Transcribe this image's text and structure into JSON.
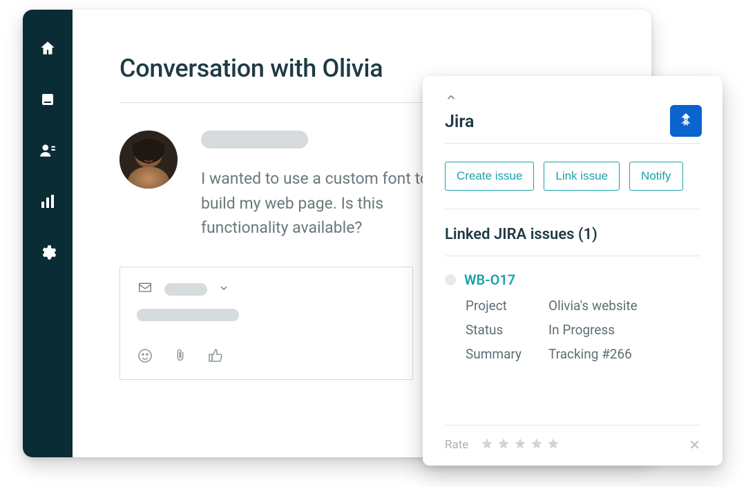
{
  "sidebar": {
    "items": [
      {
        "name": "home"
      },
      {
        "name": "inbox"
      },
      {
        "name": "contacts"
      },
      {
        "name": "reports"
      },
      {
        "name": "settings"
      }
    ]
  },
  "conversation": {
    "title": "Conversation with Olivia",
    "message": "I wanted to use a custom font to build my web page. Is this functionality available?"
  },
  "panel": {
    "title": "Jira",
    "actions": {
      "create": "Create issue",
      "link": "Link issue",
      "notify": "Notify"
    },
    "linked_label": "Linked JIRA issues (1)",
    "issue": {
      "key": "WB-O17",
      "fields": {
        "project_label": "Project",
        "project_value": "Olivia's website",
        "status_label": "Status",
        "status_value": "In Progress",
        "summary_label": "Summary",
        "summary_value": "Tracking #266"
      }
    },
    "rate_label": "Rate"
  },
  "colors": {
    "sidebar": "#0a2c34",
    "accent": "#17a2a8",
    "jira": "#0b63ce"
  }
}
